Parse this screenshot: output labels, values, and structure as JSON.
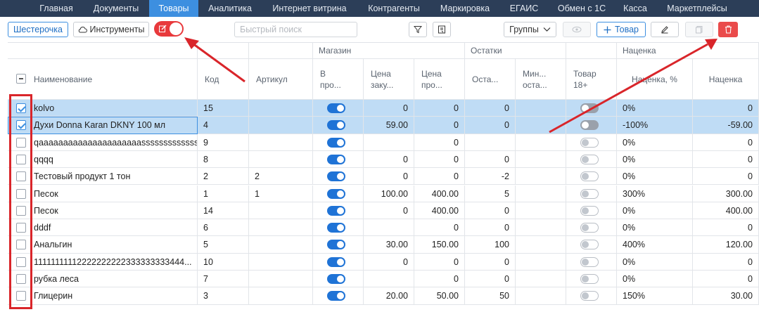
{
  "nav": {
    "tabs": [
      "Главная",
      "Документы",
      "Товары",
      "Аналитика",
      "Интернет витрина",
      "Контрагенты",
      "Маркировка",
      "ЕГАИС",
      "Обмен с 1С",
      "Касса",
      "Маркетплейсы"
    ],
    "active": "Товары"
  },
  "toolbar": {
    "shop_label": "Шестерочка",
    "tools_label": "Инструменты",
    "search_placeholder": "Быстрый поиск",
    "groups_label": "Группы",
    "add_label": "Товар"
  },
  "table": {
    "groups": {
      "shop": "Магазин",
      "stock": "Остатки",
      "markup": "Наценка"
    },
    "headers": {
      "name": "Наименование",
      "code": "Код",
      "article": "Артикул",
      "in_sale": "В\nпро...",
      "purchase_price": "Цена\nзаку...",
      "sale_price": "Цена\nпро...",
      "stock": "Оста...",
      "min_stock": "Мин...\nоста...",
      "adult": "Товар\n18+",
      "markup_pct": "Наценка, %",
      "markup": "Наценка"
    },
    "rows": [
      {
        "name": "kolvo",
        "code": "15",
        "article": "",
        "purchase": "0",
        "sale": "0",
        "stock": "0",
        "min": "",
        "markup_pct": "0%",
        "markup": "0",
        "selected": true,
        "in_sale": true
      },
      {
        "name": "Духи Donna Karan DKNY 100 мл",
        "code": "4",
        "article": "",
        "purchase": "59.00",
        "sale": "0",
        "stock": "0",
        "min": "",
        "markup_pct": "-100%",
        "markup": "-59.00",
        "selected": true,
        "in_sale": true
      },
      {
        "name": "qaaaaaaaaaaaaaaaaaaaaasssssssssssss...",
        "code": "9",
        "article": "",
        "purchase": "",
        "sale": "0",
        "stock": "",
        "min": "",
        "markup_pct": "0%",
        "markup": "0",
        "selected": false,
        "in_sale": true
      },
      {
        "name": "qqqq",
        "code": "8",
        "article": "",
        "purchase": "0",
        "sale": "0",
        "stock": "0",
        "min": "",
        "markup_pct": "0%",
        "markup": "0",
        "selected": false,
        "in_sale": true
      },
      {
        "name": "Тестовый продукт 1 тон",
        "code": "2",
        "article": "2",
        "purchase": "0",
        "sale": "0",
        "stock": "-2",
        "min": "",
        "markup_pct": "0%",
        "markup": "0",
        "selected": false,
        "in_sale": true
      },
      {
        "name": "Песок",
        "code": "1",
        "article": "1",
        "purchase": "100.00",
        "sale": "400.00",
        "stock": "5",
        "min": "",
        "markup_pct": "300%",
        "markup": "300.00",
        "selected": false,
        "in_sale": true
      },
      {
        "name": "Песок",
        "code": "14",
        "article": "",
        "purchase": "0",
        "sale": "400.00",
        "stock": "0",
        "min": "",
        "markup_pct": "0%",
        "markup": "400.00",
        "selected": false,
        "in_sale": true
      },
      {
        "name": "dddf",
        "code": "6",
        "article": "",
        "purchase": "",
        "sale": "0",
        "stock": "0",
        "min": "",
        "markup_pct": "0%",
        "markup": "0",
        "selected": false,
        "in_sale": true
      },
      {
        "name": "Анальгин",
        "code": "5",
        "article": "",
        "purchase": "30.00",
        "sale": "150.00",
        "stock": "100",
        "min": "",
        "markup_pct": "400%",
        "markup": "120.00",
        "selected": false,
        "in_sale": true
      },
      {
        "name": "11111111112222222222333333333444...",
        "code": "10",
        "article": "",
        "purchase": "0",
        "sale": "0",
        "stock": "0",
        "min": "",
        "markup_pct": "0%",
        "markup": "0",
        "selected": false,
        "in_sale": true
      },
      {
        "name": "рубка леса",
        "code": "7",
        "article": "",
        "purchase": "",
        "sale": "0",
        "stock": "0",
        "min": "",
        "markup_pct": "0%",
        "markup": "0",
        "selected": false,
        "in_sale": true
      },
      {
        "name": "Глицерин",
        "code": "3",
        "article": "",
        "purchase": "20.00",
        "sale": "50.00",
        "stock": "50",
        "min": "",
        "markup_pct": "150%",
        "markup": "30.00",
        "selected": false,
        "in_sale": true
      }
    ]
  },
  "colors": {
    "nav_bg": "#2c3e58",
    "nav_active": "#3d8fe0",
    "selected_row": "#bfdcf5",
    "annotation": "#d9252a",
    "toggle_on": "#1f73d6",
    "danger": "#ea4b4b"
  },
  "icons": [
    "cloud-icon",
    "edit-icon",
    "filter-icon",
    "export-icon",
    "chevron-down-icon",
    "eye-icon",
    "plus-icon",
    "pencil-icon",
    "copy-icon",
    "trash-icon",
    "minus-checkbox-icon"
  ]
}
